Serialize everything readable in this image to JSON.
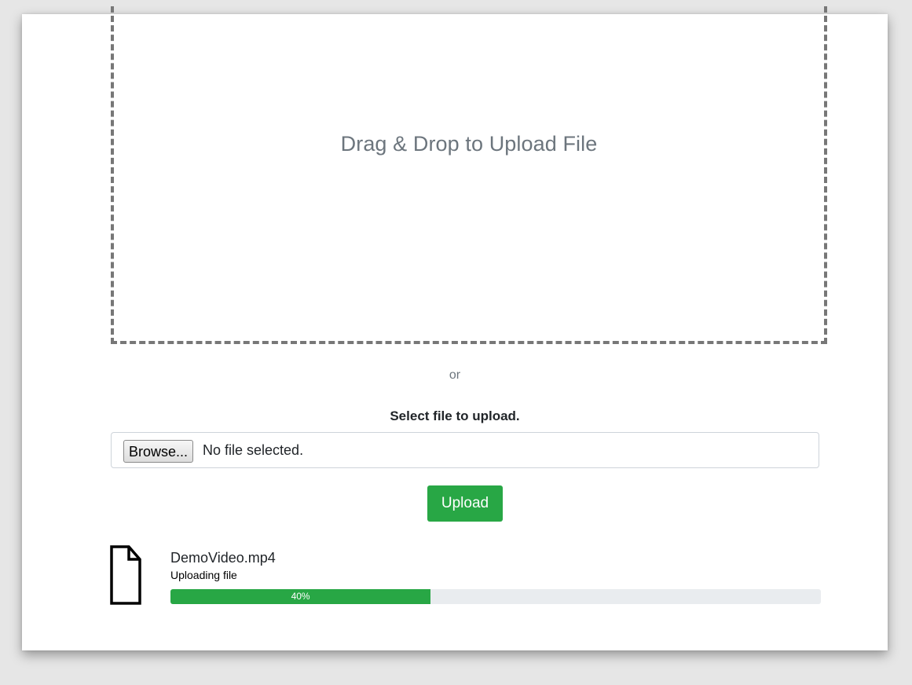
{
  "dropzone": {
    "text": "Drag & Drop to Upload File"
  },
  "separator": {
    "text": "or"
  },
  "file_select": {
    "label": "Select file to upload.",
    "browse_label": "Browse...",
    "status_text": "No file selected."
  },
  "upload_button": {
    "label": "Upload"
  },
  "upload_item": {
    "icon": "file-icon",
    "filename": "DemoVideo.mp4",
    "status": "Uploading file",
    "progress_percent": 40,
    "progress_label": "40%"
  },
  "colors": {
    "accent_green": "#28a745",
    "progress_track": "#e9ecef",
    "dropzone_border": "#777777",
    "muted_text": "#6c757d"
  }
}
